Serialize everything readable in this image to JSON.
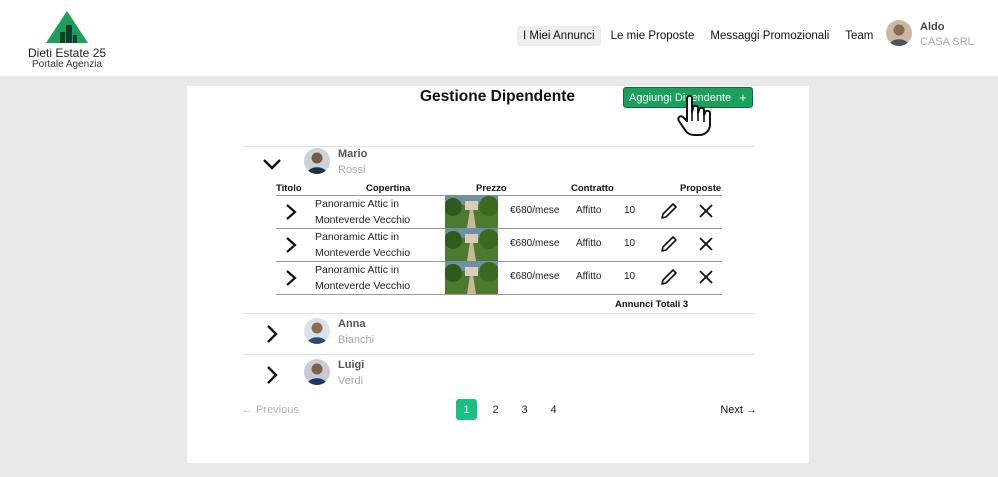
{
  "brand": {
    "name": "Dieti Estate 25",
    "subtitle": "Portale Agenzia",
    "logo_icon": "house-triangle-logo",
    "accent": "#1aa05a"
  },
  "nav": {
    "items": [
      {
        "label": "I Miei Annunci",
        "active": true
      },
      {
        "label": "Le mie Proposte",
        "active": false
      },
      {
        "label": "Messaggi Promozionali",
        "active": false
      },
      {
        "label": "Team",
        "active": false
      }
    ]
  },
  "user": {
    "name": "Aldo",
    "company": "CASA SRL"
  },
  "page": {
    "title": "Gestione Dipendente",
    "add_button": "Aggiungi Dipendente",
    "add_icon": "+"
  },
  "table": {
    "headers": {
      "title": "Titolo",
      "cover": "Copertina",
      "price": "Prezzo",
      "contract": "Contratto",
      "proposals": "Proposte"
    },
    "rows": [
      {
        "title": "Panoramic Attic in Monteverde Vecchio",
        "price": "€680/mese",
        "contract": "Affitto",
        "proposals": "10"
      },
      {
        "title": "Panoramic Attic in Monteverde Vecchio",
        "price": "€680/mese",
        "contract": "Affitto",
        "proposals": "10"
      },
      {
        "title": "Panoramic Attic in Monteverde Vecchio",
        "price": "€680/mese",
        "contract": "Affitto",
        "proposals": "10"
      }
    ],
    "totals": "Annunci Totali 3"
  },
  "employees": [
    {
      "first": "Mario",
      "last": "Rossi",
      "expanded": true
    },
    {
      "first": "Anna",
      "last": "Bianchi",
      "expanded": false
    },
    {
      "first": "Luigi",
      "last": "Verdi",
      "expanded": false
    }
  ],
  "pagination": {
    "prev": "Previous",
    "next": "Next",
    "pages": [
      "1",
      "2",
      "3",
      "4"
    ],
    "current": "1"
  }
}
